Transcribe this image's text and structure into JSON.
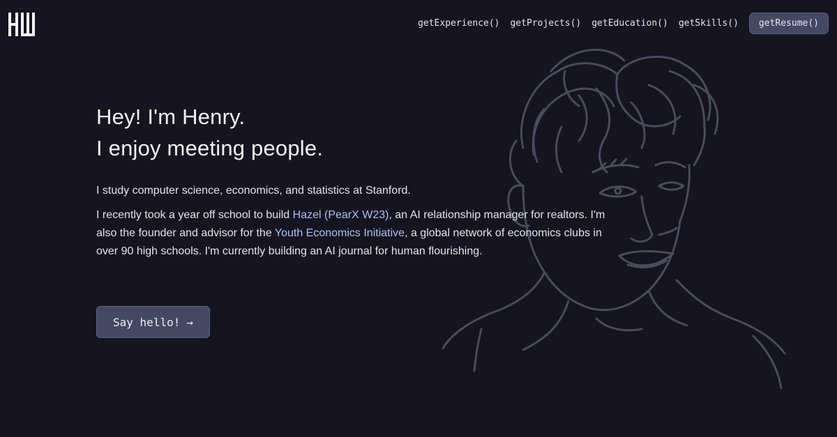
{
  "header": {
    "logo_icon": "hw-monogram-logo",
    "nav": [
      {
        "label": "getExperience()"
      },
      {
        "label": "getProjects()"
      },
      {
        "label": "getEducation()"
      },
      {
        "label": "getSkills()"
      }
    ],
    "resume_label": "getResume()"
  },
  "hero": {
    "headline_line1": "Hey! I'm Henry.",
    "headline_line2": "I enjoy meeting people.",
    "intro": "I study computer science, economics, and statistics at Stanford.",
    "bio": {
      "part1": "I recently took a year off school to build ",
      "link1": "Hazel (PearX W23)",
      "part2": ", an AI relationship manager for realtors. I'm also the founder and advisor for the ",
      "link2": "Youth Economics Initiative",
      "part3": ", a global network of economics clubs in over 90 high schools. I'm currently building an AI journal for human flourishing."
    },
    "cta_label": "Say hello!",
    "cta_icon": "arrow-right-icon"
  },
  "portrait": {
    "icon": "line-drawing-portrait"
  },
  "colors": {
    "background": "#15141f",
    "accent_button": "#454863",
    "link": "#a9c2f4",
    "portrait_stroke": "#4a4b5c"
  }
}
